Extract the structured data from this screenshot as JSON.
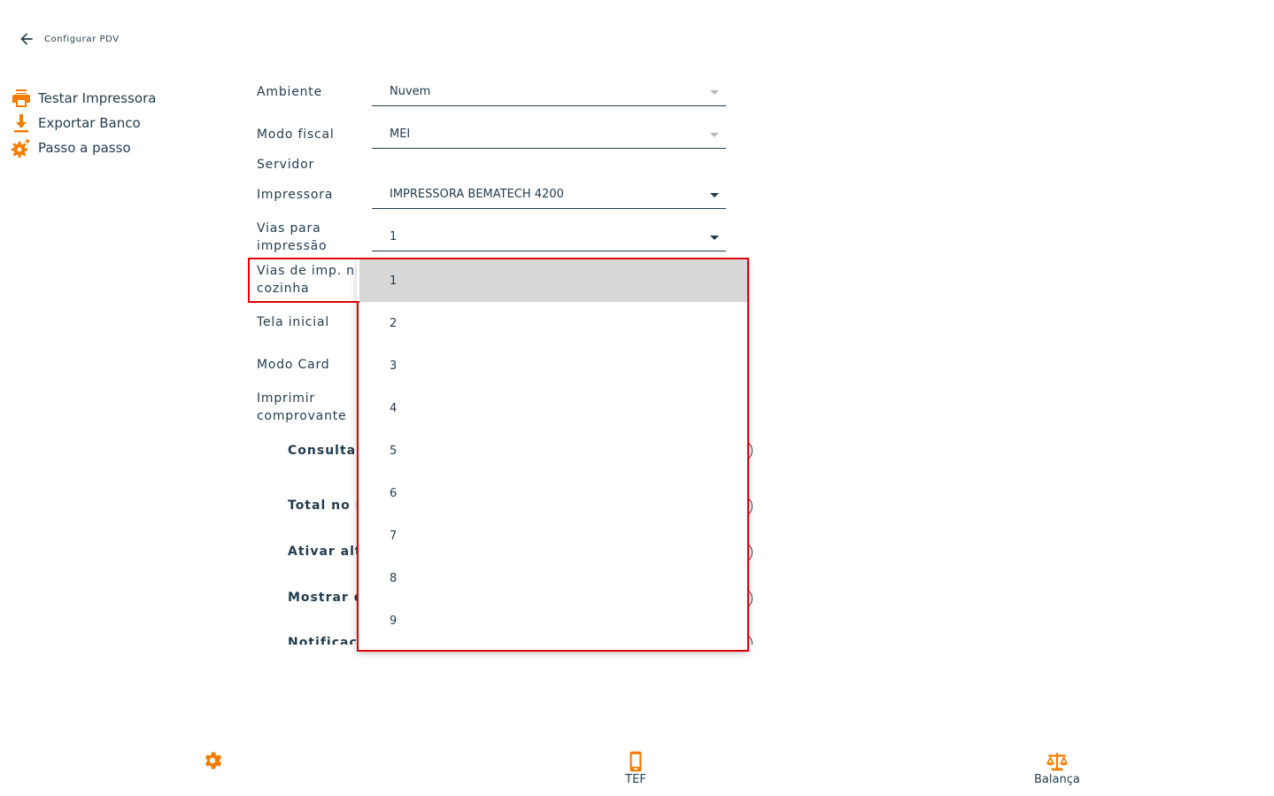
{
  "header": {
    "title": "Configurar PDV",
    "back_icon": "arrow-left-icon"
  },
  "sidebar": {
    "actions": [
      {
        "label": "Testar Impressora",
        "icon": "printer-icon"
      },
      {
        "label": "Exportar Banco",
        "icon": "download-icon"
      },
      {
        "label": "Passo a passo",
        "icon": "gear-sparkle-icon"
      }
    ]
  },
  "form": {
    "ambiente": {
      "label": "Ambiente",
      "value": "Nuvem"
    },
    "modo_fiscal": {
      "label": "Modo fiscal",
      "value": "MEI"
    },
    "servidor": {
      "label": "Servidor"
    },
    "impressora": {
      "label": "Impressora",
      "value": "IMPRESSORA BEMATECH 4200"
    },
    "vias_impressao": {
      "label_line1": "Vias para",
      "label_line2": "impressão",
      "value": "1"
    },
    "vias_cozinha": {
      "label_line1": "Vias de imp. n",
      "label_line2": "cozinha"
    },
    "tela_inicial": {
      "label": "Tela inicial"
    },
    "modo_card": {
      "label": "Modo Card"
    },
    "imprimir_comprovante": {
      "label_line1": "Imprimir",
      "label_line2": "comprovante"
    },
    "toggles": [
      "Consultar",
      "Total no r",
      "Ativar alt",
      "Mostrar d",
      "Notificaçõ"
    ]
  },
  "dropdown": {
    "selected": "1",
    "options": [
      "1",
      "2",
      "3",
      "4",
      "5",
      "6",
      "7",
      "8",
      "9"
    ]
  },
  "bottom_nav": {
    "settings": {
      "icon": "gear-icon"
    },
    "tef": {
      "label": "TEF",
      "icon": "phone-icon"
    },
    "balanca": {
      "label": "Balança",
      "icon": "scale-icon"
    }
  },
  "colors": {
    "accent": "#f57c00",
    "text": "#1f3b4d",
    "highlight": "#e0000b",
    "selected_bg": "#d7d7d7"
  }
}
